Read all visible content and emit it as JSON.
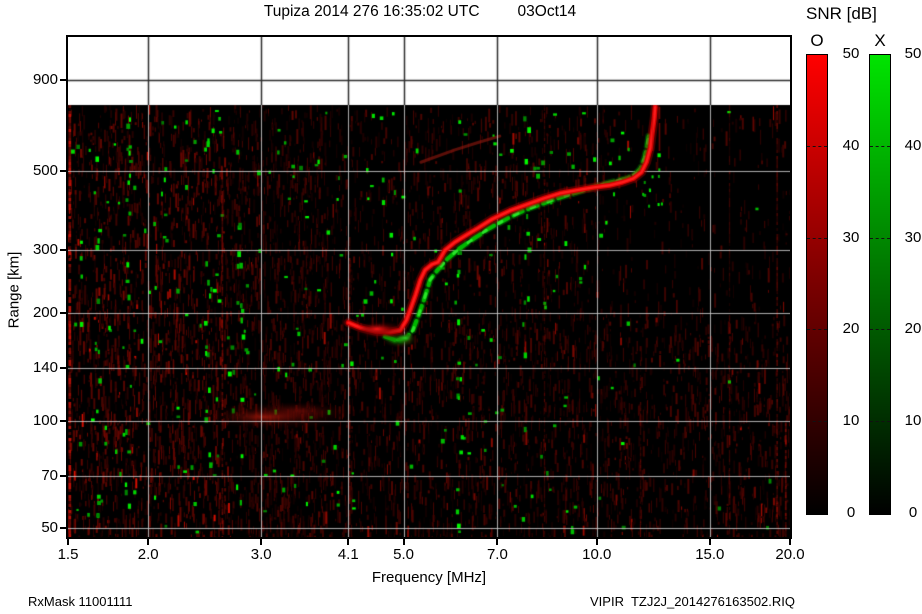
{
  "header": {
    "title": "Tupiza 2014 276 16:35:02 UTC",
    "date": "03Oct14"
  },
  "footer": {
    "rx_mask": "RxMask 11001111",
    "instrument_file": "VIPIR  TZJ2J_2014276163502.RIQ"
  },
  "axes": {
    "x": {
      "label": "Frequency [MHz]",
      "scale": "log",
      "min": 1.5,
      "max": 20.0,
      "ticks": [
        "1.5",
        "2.0",
        "3.0",
        "4.1",
        "5.0",
        "7.0",
        "10.0",
        "15.0",
        "20.0"
      ]
    },
    "y": {
      "label": "Range [km]",
      "scale": "log",
      "min": 47,
      "max": 1190,
      "ticks": [
        "900",
        "500",
        "300",
        "200",
        "140",
        "100",
        "70",
        "50"
      ]
    }
  },
  "colorbars": {
    "title": "SNR [dB]",
    "min": 0,
    "max": 50,
    "ticks": [
      "50",
      "40",
      "30",
      "20",
      "10",
      "0"
    ],
    "o": {
      "label": "O",
      "color": "#ff0000"
    },
    "x": {
      "label": "X",
      "color": "#00e400"
    }
  },
  "chart_data": {
    "type": "heatmap",
    "title": "Tupiza 2014 276 16:35:02 UTC 03Oct14",
    "xlabel": "Frequency [MHz]",
    "ylabel": "Range [km]",
    "x_scale": "log",
    "y_scale": "log",
    "xlim": [
      1.5,
      20.0
    ],
    "ylim": [
      47,
      1190
    ],
    "grid": true,
    "snr_range_db": [
      0,
      50
    ],
    "plot_bg": "#000000",
    "data_top_km": 765,
    "series": [
      {
        "name": "O-mode trace",
        "color": "#dd0000",
        "points": [
          [
            4.1,
            188
          ],
          [
            4.28,
            182
          ],
          [
            4.51,
            178
          ],
          [
            4.77,
            177
          ],
          [
            4.94,
            179
          ],
          [
            5.05,
            191
          ],
          [
            5.12,
            204
          ],
          [
            5.22,
            225
          ],
          [
            5.31,
            248
          ],
          [
            5.4,
            264
          ],
          [
            5.54,
            274
          ],
          [
            5.66,
            278
          ],
          [
            5.8,
            300
          ],
          [
            6.01,
            316
          ],
          [
            6.23,
            329
          ],
          [
            6.53,
            346
          ],
          [
            6.86,
            366
          ],
          [
            7.32,
            387
          ],
          [
            7.81,
            404
          ],
          [
            8.29,
            420
          ],
          [
            8.81,
            434
          ],
          [
            9.32,
            442
          ],
          [
            9.89,
            450
          ],
          [
            10.48,
            456
          ],
          [
            10.96,
            465
          ],
          [
            11.41,
            477
          ],
          [
            11.74,
            496
          ],
          [
            11.95,
            529
          ],
          [
            12.12,
            581
          ],
          [
            12.2,
            639
          ],
          [
            12.29,
            703
          ],
          [
            12.33,
            755
          ]
        ]
      },
      {
        "name": "X-mode trace",
        "color": "#00bb00",
        "points": [
          [
            4.68,
            172
          ],
          [
            4.85,
            168
          ],
          [
            5.04,
            170
          ],
          [
            5.17,
            179
          ],
          [
            5.28,
            198
          ],
          [
            5.38,
            218
          ],
          [
            5.5,
            248
          ],
          [
            5.62,
            261
          ],
          [
            5.84,
            283
          ],
          [
            6.12,
            304
          ],
          [
            6.46,
            325
          ],
          [
            6.81,
            346
          ],
          [
            7.27,
            369
          ],
          [
            7.76,
            390
          ],
          [
            8.29,
            407
          ],
          [
            8.81,
            423
          ],
          [
            9.32,
            436
          ],
          [
            9.78,
            448
          ],
          [
            10.23,
            459
          ],
          [
            10.7,
            468
          ],
          [
            11.17,
            477
          ],
          [
            11.49,
            490
          ],
          [
            11.7,
            508
          ],
          [
            11.87,
            543
          ],
          [
            11.99,
            589
          ],
          [
            12.08,
            645
          ]
        ]
      },
      {
        "name": "second-hop echo",
        "color": "rgba(150,25,15,0.6)",
        "points": [
          [
            5.32,
            529
          ],
          [
            6.01,
            573
          ],
          [
            6.57,
            603
          ],
          [
            7.06,
            626
          ]
        ]
      }
    ],
    "e_layer_patch": {
      "f_range": [
        2.6,
        3.9
      ],
      "km_center": 103,
      "km_spread": 10
    },
    "rfi_columns_mhz": [
      1.51,
      2.61,
      4.12,
      8.29,
      11.7,
      16.1,
      19.1,
      19.7
    ],
    "green_noise_columns_mhz": [
      1.66,
      1.85,
      2.47,
      2.77,
      6.08,
      7.72
    ]
  }
}
